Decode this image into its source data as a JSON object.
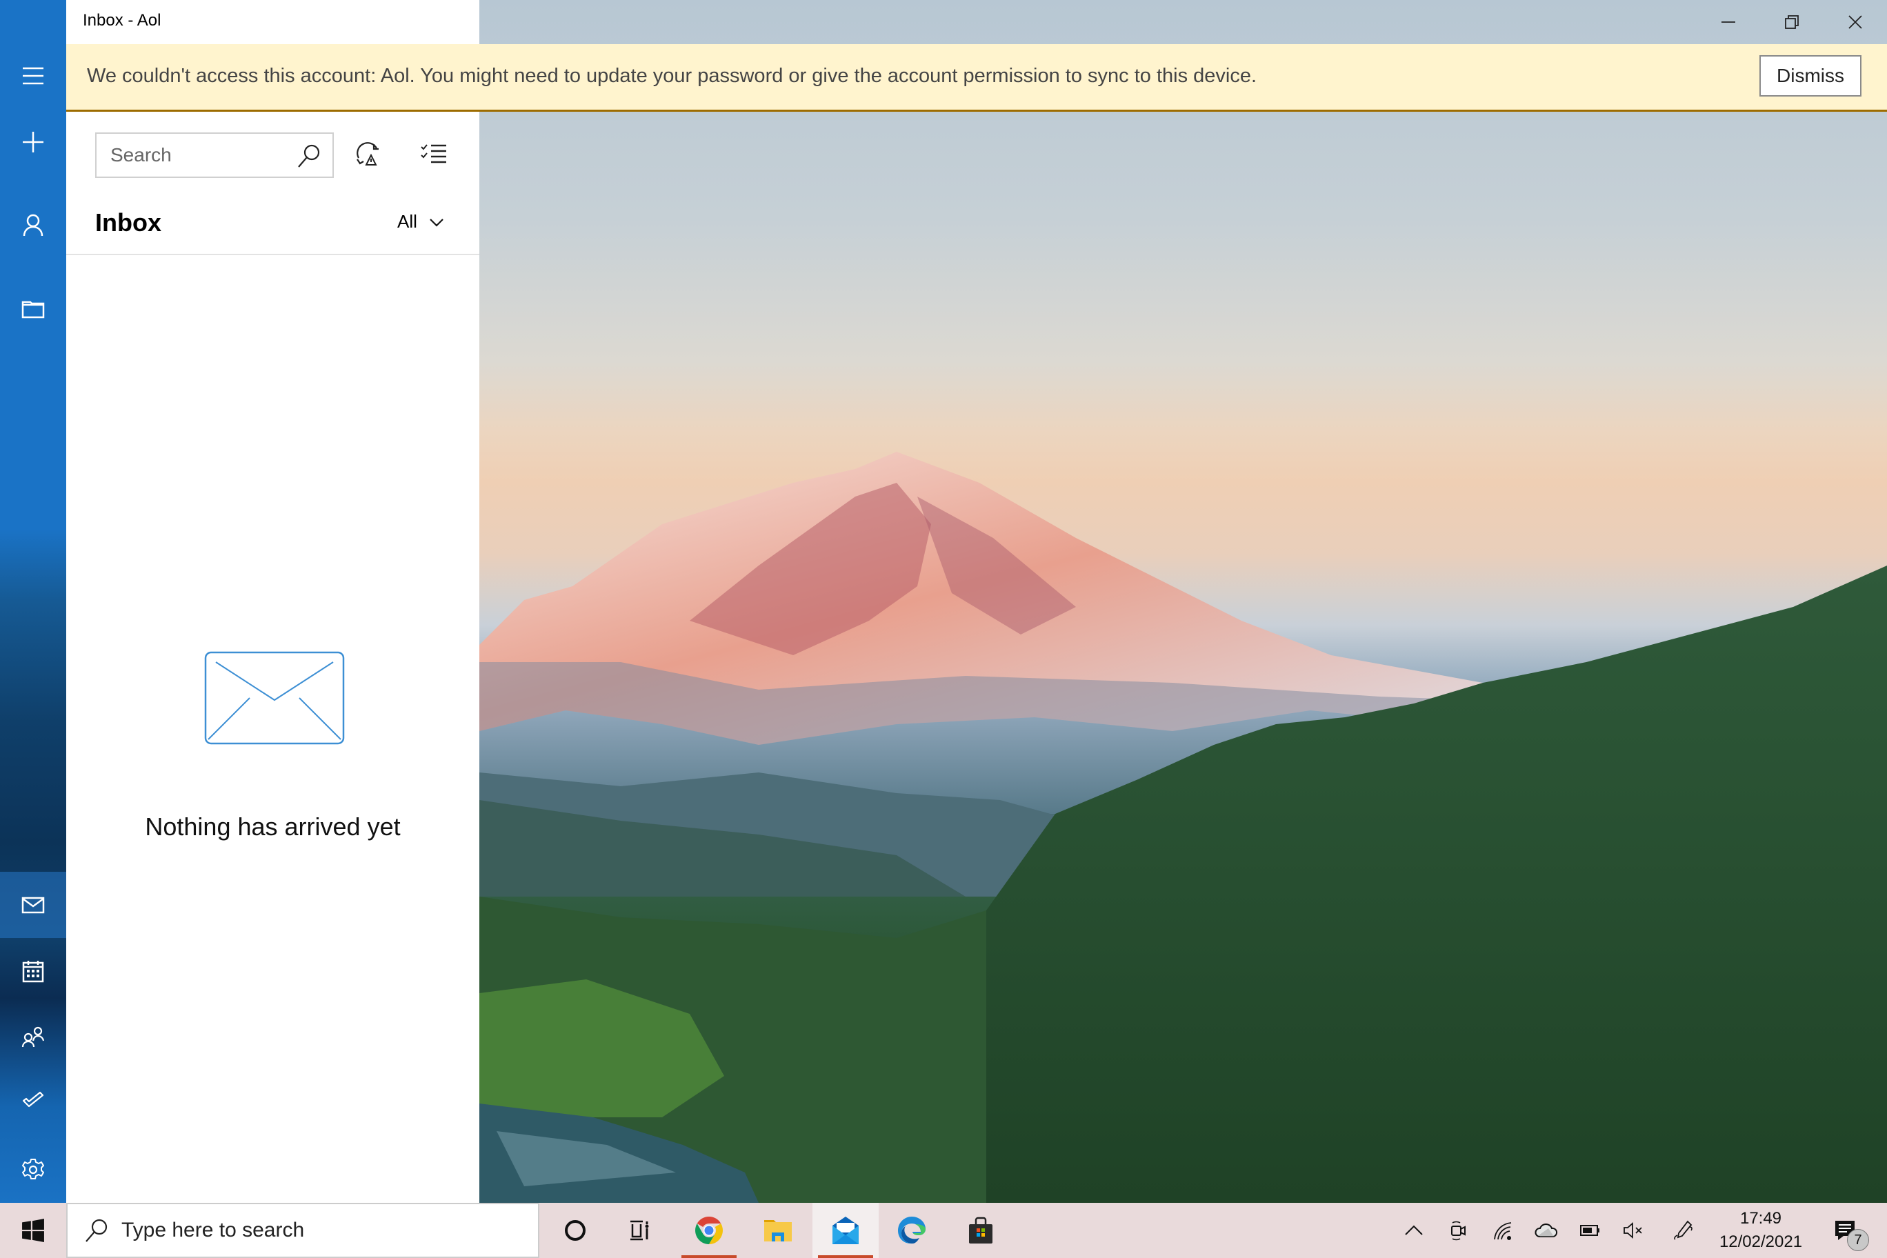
{
  "window": {
    "title": "Inbox - Aol",
    "controls": {
      "minimize": "minimize-icon",
      "restore": "restore-icon",
      "close": "close-icon"
    }
  },
  "nav_rail": {
    "top_items": [
      {
        "name": "menu",
        "icon": "hamburger-icon"
      },
      {
        "name": "new-mail",
        "icon": "plus-icon"
      },
      {
        "name": "accounts",
        "icon": "person-icon"
      },
      {
        "name": "folders",
        "icon": "folder-icon"
      }
    ],
    "bottom_items": [
      {
        "name": "mail",
        "icon": "mail-icon",
        "active": true
      },
      {
        "name": "calendar",
        "icon": "calendar-icon"
      },
      {
        "name": "people",
        "icon": "people-icon"
      },
      {
        "name": "todo",
        "icon": "checkmark-icon"
      },
      {
        "name": "settings",
        "icon": "gear-icon"
      }
    ],
    "accent": "#1a73c6"
  },
  "banner": {
    "message": "We couldn't access this account: Aol. You might need to update your password or give the account permission to sync to this device.",
    "dismiss_label": "Dismiss",
    "background": "#fff4ce",
    "border": "#9d6c00"
  },
  "list_pane": {
    "search": {
      "placeholder": "Search",
      "value": ""
    },
    "toolbar": {
      "sync_icon": "sync-warning-icon",
      "select_icon": "select-mode-icon"
    },
    "heading": "Inbox",
    "filter": {
      "selected": "All"
    },
    "empty_state": {
      "icon": "envelope-icon",
      "message": "Nothing has arrived yet"
    }
  },
  "taskbar": {
    "search_placeholder": "Type here to search",
    "pinned": [
      {
        "name": "cortana",
        "icon": "circle-icon"
      },
      {
        "name": "task-view",
        "icon": "task-view-icon"
      },
      {
        "name": "chrome",
        "icon": "chrome-icon",
        "running": true
      },
      {
        "name": "file-explorer",
        "icon": "folder-icon"
      },
      {
        "name": "mail",
        "icon": "mail-app-icon",
        "running": true,
        "active": true
      },
      {
        "name": "edge",
        "icon": "edge-icon"
      },
      {
        "name": "store",
        "icon": "store-icon"
      }
    ],
    "tray": [
      {
        "name": "show-hidden",
        "icon": "chevron-up-icon"
      },
      {
        "name": "meet-now",
        "icon": "meet-now-icon"
      },
      {
        "name": "network",
        "icon": "wifi-icon"
      },
      {
        "name": "onedrive",
        "icon": "cloud-icon"
      },
      {
        "name": "battery",
        "icon": "battery-icon"
      },
      {
        "name": "volume",
        "icon": "volume-muted-icon"
      },
      {
        "name": "pen",
        "icon": "pen-icon"
      }
    ],
    "clock": {
      "time": "17:49",
      "date": "12/02/2021"
    },
    "notifications": {
      "count": "7"
    }
  }
}
